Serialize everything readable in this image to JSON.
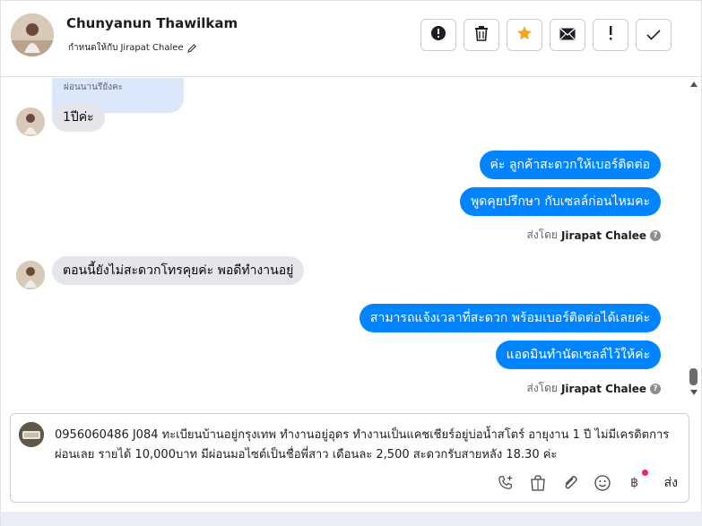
{
  "header": {
    "contact_name": "Chunyanun Thawilkam",
    "assign_prefix": "กำหนดให้กับ",
    "assignee": "Jirapat Chalee",
    "actions": [
      {
        "name": "spam-button",
        "icon": "alert-circle-icon"
      },
      {
        "name": "delete-button",
        "icon": "trash-icon"
      },
      {
        "name": "star-button",
        "icon": "star-icon",
        "color": "#f5a623"
      },
      {
        "name": "mark-unread-button",
        "icon": "envelope-icon"
      },
      {
        "name": "follow-up-button",
        "icon": "exclamation-icon"
      },
      {
        "name": "mark-done-button",
        "icon": "check-icon"
      }
    ]
  },
  "messages": {
    "quoted_text": "ผ่อนนานรึยังคะ",
    "m1": "1ปีค่ะ",
    "m2": "ค่ะ ลูกค้าสะดวกให้เบอร์ติดต่อ",
    "m3": "พูดคุยปรึกษา กับเซลล์ก่อนไหมคะ",
    "sent_by_1": {
      "prefix": "ส่งโดย",
      "agent": "Jirapat Chalee"
    },
    "m4": "ตอนนี้ยังไม่สะดวกโทรคุยค่ะ พอดีทำงานอยู่",
    "m5": "สามารถแจ้งเวลาที่สะดวก พร้อมเบอร์ติดต่อได้เลยค่ะ",
    "m6": "แอดมินทำนัดเซลล์ไว้ให้ค่ะ",
    "sent_by_2": {
      "prefix": "ส่งโดย",
      "agent": "Jirapat Chalee"
    }
  },
  "composer": {
    "text": "0956060486 J084 ทะเบียนบ้านอยู่กรุงเทพ ทำงานอยู่อุดร ทำงานเป็นแคชเชียร์อยู่บ่อน้ำสโตร์ อายุงาน 1 ปี ไม่มีเครดิตการผ่อนเลย รายได้ 10,000บาท มีผ่อนมอไซต์เป็นชื่อพี่สาว เดือนละ 2,500 สะดวกรับสายหลัง 18.30 ค่ะ",
    "baht_symbol": "฿",
    "send_label": "ส่ง",
    "help_glyph": "?"
  },
  "colors": {
    "outgoing_bubble": "#0084ff",
    "incoming_bubble": "#e4e6eb",
    "quoted_bubble": "#dbe7fb",
    "notification_dot": "#f02849"
  }
}
